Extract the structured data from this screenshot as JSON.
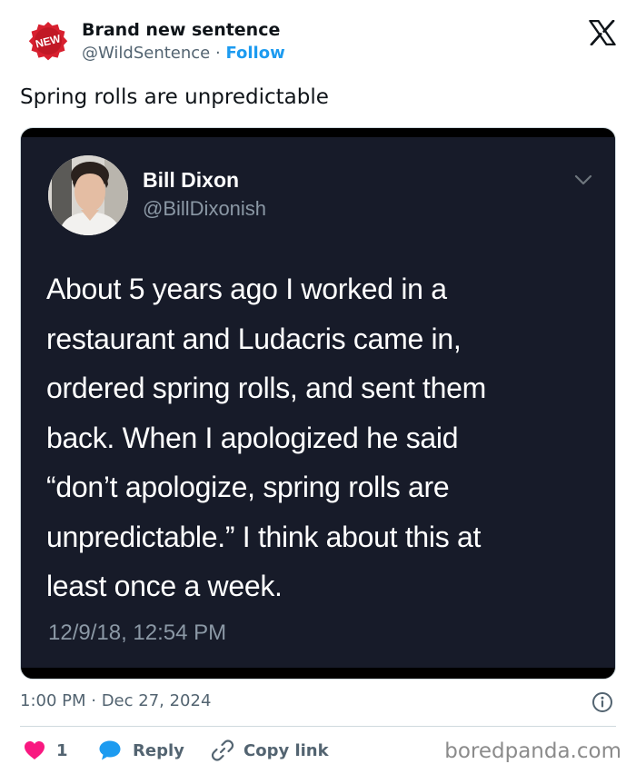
{
  "author": {
    "badge_text": "NEW",
    "name": "Brand new sentence",
    "handle": "@WildSentence",
    "separator": "·",
    "follow_label": "Follow"
  },
  "tweet": {
    "text": "Spring rolls are unpredictable",
    "timestamp": "1:00 PM · Dec 27, 2024"
  },
  "embedded": {
    "name": "Bill Dixon",
    "handle": "@BillDixonish",
    "lines": [
      "About 5 years ago I worked in a",
      "restaurant and Ludacris came in,",
      "ordered spring rolls, and sent them",
      "back. When I apologized he said",
      "“don’t apologize, spring rolls are",
      "unpredictable.” I think about this at",
      "least once a week."
    ],
    "timestamp": "12/9/18, 12:54 PM"
  },
  "actions": {
    "like_count": "1",
    "reply_label": "Reply",
    "copy_label": "Copy link"
  },
  "watermark": "boredpanda.com",
  "icons": {
    "close": "x-logo-icon",
    "like": "heart-icon",
    "reply": "speech-bubble-icon",
    "copy": "link-icon",
    "info": "info-icon",
    "menu": "chevron-down-icon"
  },
  "colors": {
    "accent": "#1d9bf0",
    "like": "#f91880",
    "badge": "#d8202f",
    "embedded_bg": "#171b29"
  }
}
